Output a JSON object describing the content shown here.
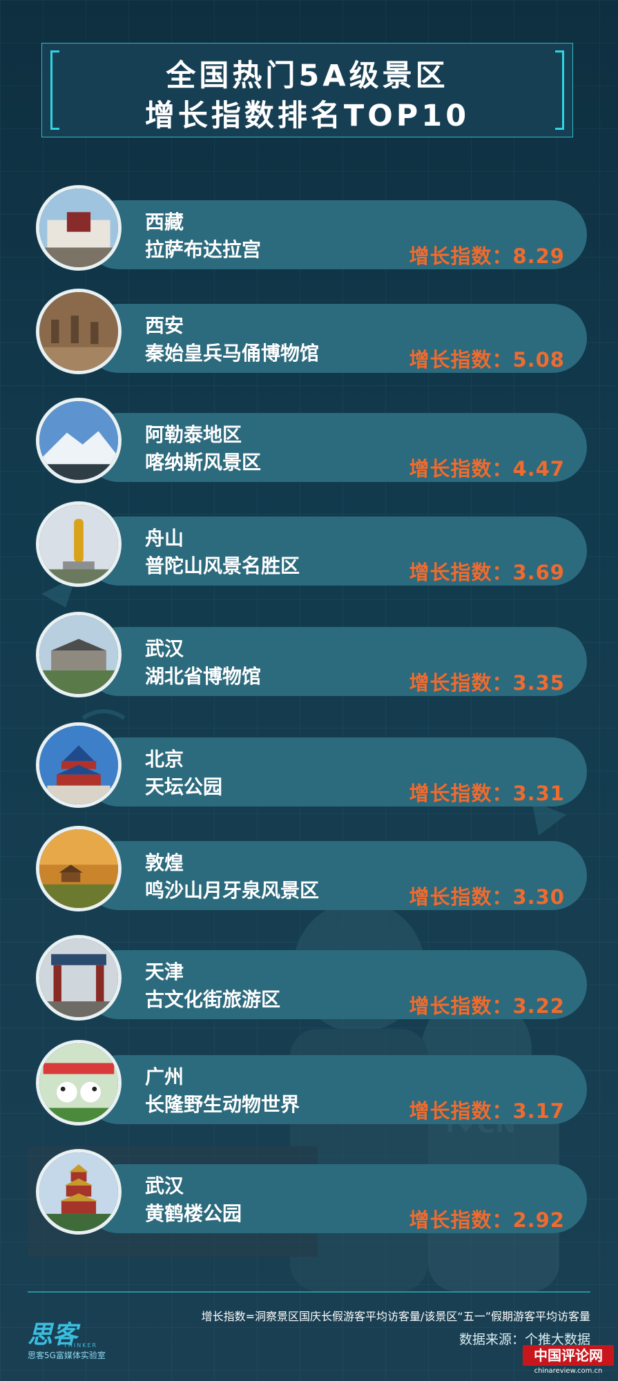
{
  "title": {
    "line1": "全国热门5A级景区",
    "line2": "增长指数排名TOP10"
  },
  "rankings": [
    {
      "city": "西藏",
      "site": "拉萨布达拉宫",
      "label": "增长指数：8.29",
      "value": 8.29,
      "photo": "potala-palace"
    },
    {
      "city": "西安",
      "site": "秦始皇兵马俑博物馆",
      "label": "增长指数：5.08",
      "value": 5.08,
      "photo": "terracotta-army"
    },
    {
      "city": "阿勒泰地区",
      "site": "喀纳斯风景区",
      "label": "增长指数：4.47",
      "value": 4.47,
      "photo": "snow-mountain"
    },
    {
      "city": "舟山",
      "site": "普陀山风景名胜区",
      "label": "增长指数：3.69",
      "value": 3.69,
      "photo": "golden-guanyin-statue"
    },
    {
      "city": "武汉",
      "site": "湖北省博物馆",
      "label": "增长指数：3.35",
      "value": 3.35,
      "photo": "museum-building"
    },
    {
      "city": "北京",
      "site": "天坛公园",
      "label": "增长指数：3.31",
      "value": 3.31,
      "photo": "temple-of-heaven"
    },
    {
      "city": "敦煌",
      "site": "鸣沙山月牙泉风景区",
      "label": "增长指数：3.30",
      "value": 3.3,
      "photo": "desert-pavilion"
    },
    {
      "city": "天津",
      "site": "古文化街旅游区",
      "label": "增长指数：3.22",
      "value": 3.22,
      "photo": "culture-street-gate"
    },
    {
      "city": "广州",
      "site": "长隆野生动物世界",
      "label": "增长指数：3.17",
      "value": 3.17,
      "photo": "panda-park-entrance"
    },
    {
      "city": "武汉",
      "site": "黄鹤楼公园",
      "label": "增长指数：2.92",
      "value": 2.92,
      "photo": "yellow-crane-tower"
    }
  ],
  "footer": {
    "logo": "思客",
    "logo_en": "THINKER",
    "logo_sub": "思客5G富媒体实验室",
    "formula": "增长指数=洞察景区国庆长假游客平均访客量/该景区“五一”假期游客平均访客量",
    "source": "数据来源：个推大数据"
  },
  "watermark": {
    "top": "中国评论网",
    "bottom": "chinareview.com.cn"
  },
  "colors": {
    "background": "#123a4d",
    "pill": "#2c6a7d",
    "accent": "#f06b2e",
    "frame": "#2fd6e2"
  }
}
